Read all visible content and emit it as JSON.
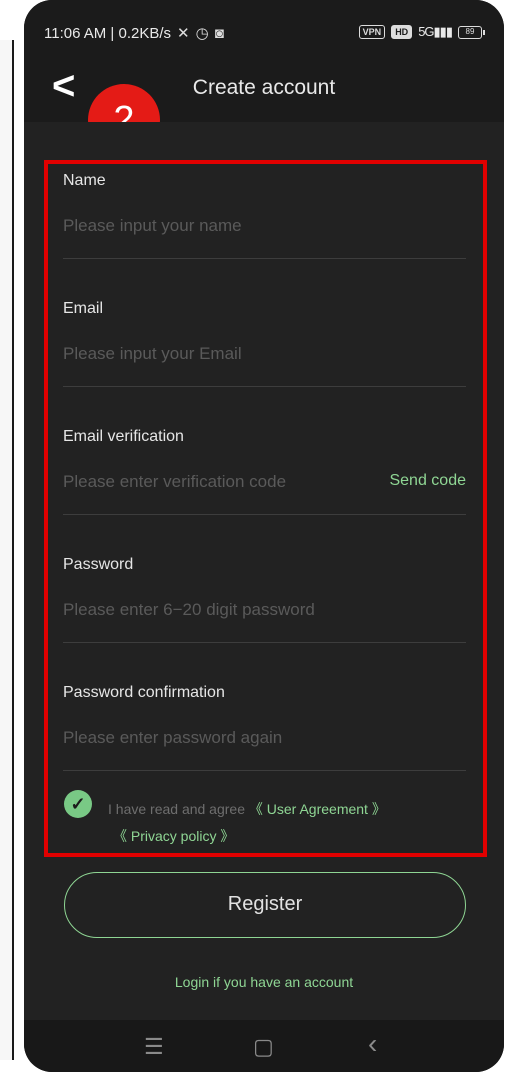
{
  "status_bar": {
    "time_network": "11:06 AM | 0.2KB/s",
    "vpn_label": "VPN",
    "hd_label": "HD",
    "signal_label": "5G",
    "battery_level": "89"
  },
  "header": {
    "back_icon": "<",
    "title": "Create account",
    "step_badge": "2"
  },
  "form": {
    "name_label": "Name",
    "name_placeholder": "Please input your name",
    "email_label": "Email",
    "email_placeholder": "Please input your Email",
    "verification_label": "Email verification",
    "verification_placeholder": "Please enter verification code",
    "send_code": "Send code",
    "password_label": "Password",
    "password_placeholder": "Please enter 6−20 digit password",
    "confirm_label": "Password confirmation",
    "confirm_placeholder": "Please enter password again"
  },
  "agreement": {
    "text": "I have read and agree",
    "user_agreement": "《 User Agreement 》",
    "privacy_policy": "《 Privacy policy 》",
    "checked": true
  },
  "actions": {
    "register": "Register",
    "login_link": "Login if you have an account"
  },
  "nav": {
    "menu_icon": "☰",
    "home_icon": "▢",
    "back_icon": "‹"
  },
  "colors": {
    "accent": "#8fd694",
    "highlight": "#e10000",
    "badge": "#e41b16"
  }
}
